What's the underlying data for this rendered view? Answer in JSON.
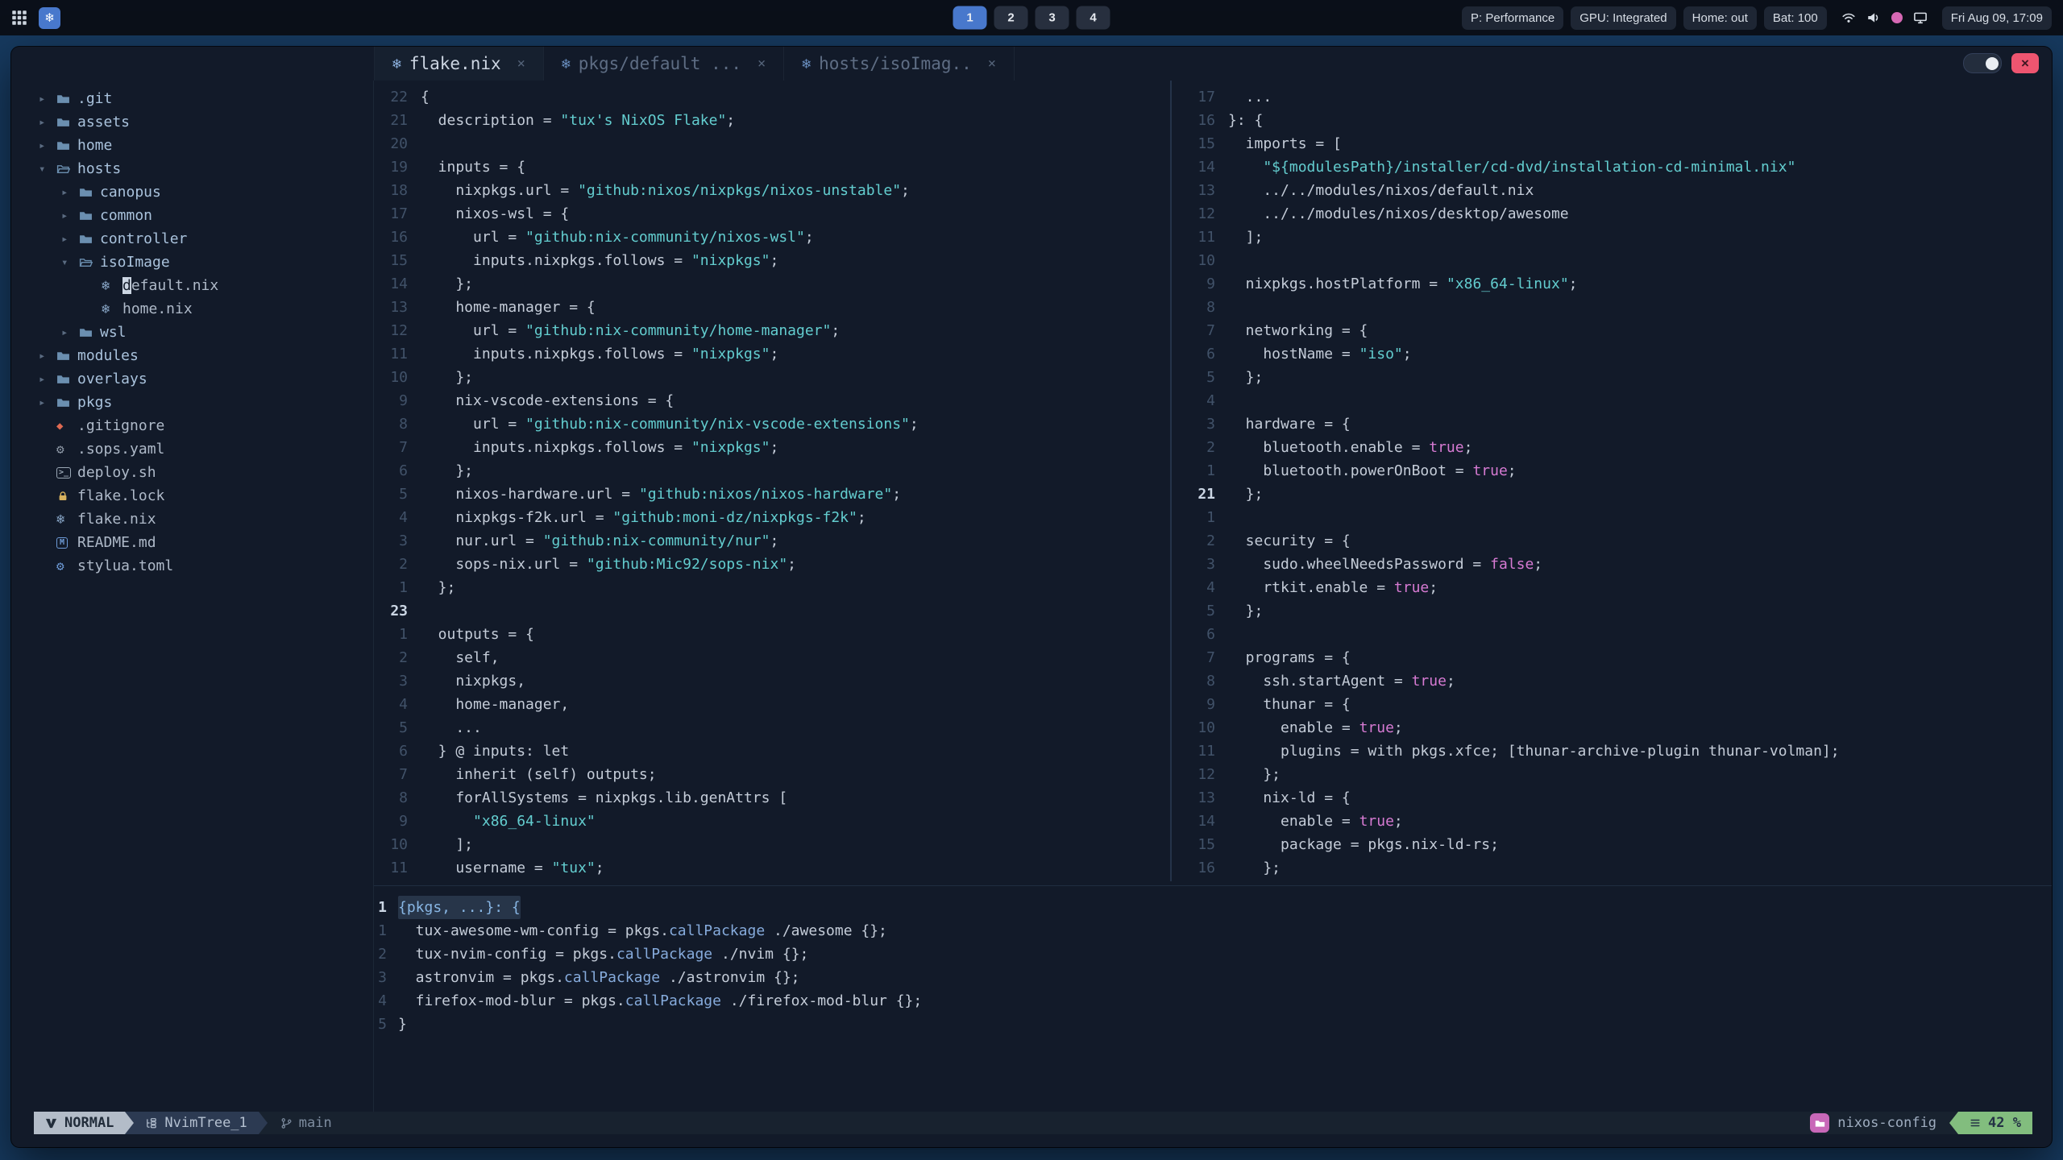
{
  "topbar": {
    "workspaces": {
      "items": [
        "1",
        "2",
        "3",
        "4"
      ],
      "active": "1"
    },
    "pills": [
      "P: Performance",
      "GPU: Integrated",
      "Home: out",
      "Bat: 100"
    ],
    "clock": "Fri Aug 09, 17:09"
  },
  "window": {
    "tabs": [
      {
        "label": "flake.nix",
        "active": true
      },
      {
        "label": "pkgs/default ...",
        "active": false
      },
      {
        "label": "hosts/isoImag..",
        "active": false
      }
    ]
  },
  "filetree": {
    "items": [
      {
        "label": ".git",
        "kind": "dir",
        "icon": "folder",
        "chev": "right",
        "depth": 0
      },
      {
        "label": "assets",
        "kind": "dir",
        "icon": "folder",
        "chev": "right",
        "depth": 0
      },
      {
        "label": "home",
        "kind": "dir",
        "icon": "folder",
        "chev": "right",
        "depth": 0
      },
      {
        "label": "hosts",
        "kind": "dir",
        "icon": "folder-open",
        "chev": "down",
        "depth": 0
      },
      {
        "label": "canopus",
        "kind": "dir",
        "icon": "folder",
        "chev": "right",
        "depth": 1
      },
      {
        "label": "common",
        "kind": "dir",
        "icon": "folder",
        "chev": "right",
        "depth": 1
      },
      {
        "label": "controller",
        "kind": "dir",
        "icon": "folder",
        "chev": "right",
        "depth": 1
      },
      {
        "label": "isoImage",
        "kind": "dir",
        "icon": "folder-open",
        "chev": "down",
        "depth": 1
      },
      {
        "label": "default.nix",
        "kind": "file",
        "icon": "nix",
        "depth": 2,
        "cursor": true
      },
      {
        "label": "home.nix",
        "kind": "file",
        "icon": "nix",
        "depth": 2
      },
      {
        "label": "wsl",
        "kind": "dir",
        "icon": "folder",
        "chev": "right",
        "depth": 1
      },
      {
        "label": "modules",
        "kind": "dir",
        "icon": "folder",
        "chev": "right",
        "depth": 0
      },
      {
        "label": "overlays",
        "kind": "dir",
        "icon": "folder",
        "chev": "right",
        "depth": 0
      },
      {
        "label": "pkgs",
        "kind": "dir",
        "icon": "folder",
        "chev": "right",
        "depth": 0
      },
      {
        "label": ".gitignore",
        "kind": "file",
        "icon": "git",
        "depth": 0
      },
      {
        "label": ".sops.yaml",
        "kind": "file",
        "icon": "gear",
        "depth": 0
      },
      {
        "label": "deploy.sh",
        "kind": "file",
        "icon": "sh",
        "depth": 0
      },
      {
        "label": "flake.lock",
        "kind": "file",
        "icon": "lock",
        "depth": 0
      },
      {
        "label": "flake.nix",
        "kind": "file",
        "icon": "nix",
        "depth": 0
      },
      {
        "label": "README.md",
        "kind": "file",
        "icon": "md",
        "depth": 0
      },
      {
        "label": "stylua.toml",
        "kind": "file",
        "icon": "toml",
        "depth": 0
      }
    ]
  },
  "editors": {
    "left": {
      "lines": [
        {
          "n": "22",
          "seg": [
            [
              "n",
              "{"
            ]
          ]
        },
        {
          "n": "21",
          "seg": [
            [
              "n",
              "  description = "
            ],
            [
              "s",
              "\"tux's NixOS Flake\""
            ],
            [
              "n",
              ";"
            ]
          ]
        },
        {
          "n": "20",
          "seg": []
        },
        {
          "n": "19",
          "seg": [
            [
              "n",
              "  inputs = {"
            ]
          ]
        },
        {
          "n": "18",
          "seg": [
            [
              "n",
              "    nixpkgs.url = "
            ],
            [
              "s",
              "\"github:nixos/nixpkgs/nixos-unstable\""
            ],
            [
              "n",
              ";"
            ]
          ]
        },
        {
          "n": "17",
          "seg": [
            [
              "n",
              "    nixos-wsl = {"
            ]
          ]
        },
        {
          "n": "16",
          "seg": [
            [
              "n",
              "      url = "
            ],
            [
              "s",
              "\"github:nix-community/nixos-wsl\""
            ],
            [
              "n",
              ";"
            ]
          ]
        },
        {
          "n": "15",
          "seg": [
            [
              "n",
              "      inputs.nixpkgs.follows = "
            ],
            [
              "s",
              "\"nixpkgs\""
            ],
            [
              "n",
              ";"
            ]
          ]
        },
        {
          "n": "14",
          "seg": [
            [
              "n",
              "    };"
            ]
          ]
        },
        {
          "n": "13",
          "seg": [
            [
              "n",
              "    home-manager = {"
            ]
          ]
        },
        {
          "n": "12",
          "seg": [
            [
              "n",
              "      url = "
            ],
            [
              "s",
              "\"github:nix-community/home-manager\""
            ],
            [
              "n",
              ";"
            ]
          ]
        },
        {
          "n": "11",
          "seg": [
            [
              "n",
              "      inputs.nixpkgs.follows = "
            ],
            [
              "s",
              "\"nixpkgs\""
            ],
            [
              "n",
              ";"
            ]
          ]
        },
        {
          "n": "10",
          "seg": [
            [
              "n",
              "    };"
            ]
          ]
        },
        {
          "n": "9",
          "seg": [
            [
              "n",
              "    nix-vscode-extensions = {"
            ]
          ]
        },
        {
          "n": "8",
          "seg": [
            [
              "n",
              "      url = "
            ],
            [
              "s",
              "\"github:nix-community/nix-vscode-extensions\""
            ],
            [
              "n",
              ";"
            ]
          ]
        },
        {
          "n": "7",
          "seg": [
            [
              "n",
              "      inputs.nixpkgs.follows = "
            ],
            [
              "s",
              "\"nixpkgs\""
            ],
            [
              "n",
              ";"
            ]
          ]
        },
        {
          "n": "6",
          "seg": [
            [
              "n",
              "    };"
            ]
          ]
        },
        {
          "n": "5",
          "seg": [
            [
              "n",
              "    nixos-hardware.url = "
            ],
            [
              "s",
              "\"github:nixos/nixos-hardware\""
            ],
            [
              "n",
              ";"
            ]
          ]
        },
        {
          "n": "4",
          "seg": [
            [
              "n",
              "    nixpkgs-f2k.url = "
            ],
            [
              "s",
              "\"github:moni-dz/nixpkgs-f2k\""
            ],
            [
              "n",
              ";"
            ]
          ]
        },
        {
          "n": "3",
          "seg": [
            [
              "n",
              "    nur.url = "
            ],
            [
              "s",
              "\"github:nix-community/nur\""
            ],
            [
              "n",
              ";"
            ]
          ]
        },
        {
          "n": "2",
          "seg": [
            [
              "n",
              "    sops-nix.url = "
            ],
            [
              "s",
              "\"github:Mic92/sops-nix\""
            ],
            [
              "n",
              ";"
            ]
          ]
        },
        {
          "n": "1",
          "seg": [
            [
              "n",
              "  };"
            ]
          ]
        },
        {
          "n": "23",
          "cur": true,
          "seg": []
        },
        {
          "n": "1",
          "seg": [
            [
              "n",
              "  outputs = {"
            ]
          ]
        },
        {
          "n": "2",
          "seg": [
            [
              "n",
              "    self,"
            ]
          ]
        },
        {
          "n": "3",
          "seg": [
            [
              "n",
              "    nixpkgs,"
            ]
          ]
        },
        {
          "n": "4",
          "seg": [
            [
              "n",
              "    home-manager,"
            ]
          ]
        },
        {
          "n": "5",
          "seg": [
            [
              "n",
              "    ..."
            ]
          ]
        },
        {
          "n": "6",
          "seg": [
            [
              "n",
              "  } @ inputs: let"
            ]
          ]
        },
        {
          "n": "7",
          "seg": [
            [
              "n",
              "    inherit (self) outputs;"
            ]
          ]
        },
        {
          "n": "8",
          "seg": [
            [
              "n",
              "    forAllSystems = nixpkgs.lib.genAttrs ["
            ]
          ]
        },
        {
          "n": "9",
          "seg": [
            [
              "s",
              "      \"x86_64-linux\""
            ]
          ]
        },
        {
          "n": "10",
          "seg": [
            [
              "n",
              "    ];"
            ]
          ]
        },
        {
          "n": "11",
          "seg": [
            [
              "n",
              "    username = "
            ],
            [
              "s",
              "\"tux\""
            ],
            [
              "n",
              ";"
            ]
          ]
        }
      ]
    },
    "right": {
      "lines": [
        {
          "n": "17",
          "seg": [
            [
              "n",
              "  ..."
            ]
          ]
        },
        {
          "n": "16",
          "seg": [
            [
              "n",
              "}: {"
            ]
          ]
        },
        {
          "n": "15",
          "seg": [
            [
              "n",
              "  imports = ["
            ]
          ]
        },
        {
          "n": "14",
          "seg": [
            [
              "s",
              "    \"${modulesPath}/installer/cd-dvd/installation-cd-minimal.nix\""
            ]
          ]
        },
        {
          "n": "13",
          "seg": [
            [
              "n",
              "    ../../modules/nixos/default.nix"
            ]
          ]
        },
        {
          "n": "12",
          "seg": [
            [
              "n",
              "    ../../modules/nixos/desktop/awesome"
            ]
          ]
        },
        {
          "n": "11",
          "seg": [
            [
              "n",
              "  ];"
            ]
          ]
        },
        {
          "n": "10",
          "seg": []
        },
        {
          "n": "9",
          "seg": [
            [
              "n",
              "  nixpkgs.hostPlatform = "
            ],
            [
              "s",
              "\"x86_64-linux\""
            ],
            [
              "n",
              ";"
            ]
          ]
        },
        {
          "n": "8",
          "seg": []
        },
        {
          "n": "7",
          "seg": [
            [
              "n",
              "  networking = {"
            ]
          ]
        },
        {
          "n": "6",
          "seg": [
            [
              "n",
              "    hostName = "
            ],
            [
              "s",
              "\"iso\""
            ],
            [
              "n",
              ";"
            ]
          ]
        },
        {
          "n": "5",
          "seg": [
            [
              "n",
              "  };"
            ]
          ]
        },
        {
          "n": "4",
          "seg": []
        },
        {
          "n": "3",
          "seg": [
            [
              "n",
              "  hardware = {"
            ]
          ]
        },
        {
          "n": "2",
          "seg": [
            [
              "n",
              "    bluetooth.enable = "
            ],
            [
              "b",
              "true"
            ],
            [
              "n",
              ";"
            ]
          ]
        },
        {
          "n": "1",
          "seg": [
            [
              "n",
              "    bluetooth.powerOnBoot = "
            ],
            [
              "b",
              "true"
            ],
            [
              "n",
              ";"
            ]
          ]
        },
        {
          "n": "21",
          "cur": true,
          "seg": [
            [
              "n",
              "  };"
            ]
          ]
        },
        {
          "n": "1",
          "seg": []
        },
        {
          "n": "2",
          "seg": [
            [
              "n",
              "  security = {"
            ]
          ]
        },
        {
          "n": "3",
          "seg": [
            [
              "n",
              "    sudo.wheelNeedsPassword = "
            ],
            [
              "b",
              "false"
            ],
            [
              "n",
              ";"
            ]
          ]
        },
        {
          "n": "4",
          "seg": [
            [
              "n",
              "    rtkit.enable = "
            ],
            [
              "b",
              "true"
            ],
            [
              "n",
              ";"
            ]
          ]
        },
        {
          "n": "5",
          "seg": [
            [
              "n",
              "  };"
            ]
          ]
        },
        {
          "n": "6",
          "seg": []
        },
        {
          "n": "7",
          "seg": [
            [
              "n",
              "  programs = {"
            ]
          ]
        },
        {
          "n": "8",
          "seg": [
            [
              "n",
              "    ssh.startAgent = "
            ],
            [
              "b",
              "true"
            ],
            [
              "n",
              ";"
            ]
          ]
        },
        {
          "n": "9",
          "seg": [
            [
              "n",
              "    thunar = {"
            ]
          ]
        },
        {
          "n": "10",
          "seg": [
            [
              "n",
              "      enable = "
            ],
            [
              "b",
              "true"
            ],
            [
              "n",
              ";"
            ]
          ]
        },
        {
          "n": "11",
          "seg": [
            [
              "n",
              "      plugins = with pkgs.xfce; [thunar-archive-plugin thunar-volman];"
            ]
          ]
        },
        {
          "n": "12",
          "seg": [
            [
              "n",
              "    };"
            ]
          ]
        },
        {
          "n": "13",
          "seg": [
            [
              "n",
              "    nix-ld = {"
            ]
          ]
        },
        {
          "n": "14",
          "seg": [
            [
              "n",
              "      enable = "
            ],
            [
              "b",
              "true"
            ],
            [
              "n",
              ";"
            ]
          ]
        },
        {
          "n": "15",
          "seg": [
            [
              "n",
              "      package = pkgs.nix-ld-rs;"
            ]
          ]
        },
        {
          "n": "16",
          "seg": [
            [
              "n",
              "    };"
            ]
          ]
        }
      ]
    },
    "bottom": {
      "lines": [
        {
          "n": "1",
          "cur": true,
          "hl": true,
          "seg": [
            [
              "h",
              "{pkgs, ...}: {"
            ]
          ]
        },
        {
          "n": "1",
          "seg": [
            [
              "n",
              "  tux-awesome-wm-config = pkgs."
            ],
            [
              "f",
              "callPackage"
            ],
            [
              "n",
              " ./awesome {};"
            ]
          ]
        },
        {
          "n": "2",
          "seg": [
            [
              "n",
              "  tux-nvim-config = pkgs."
            ],
            [
              "f",
              "callPackage"
            ],
            [
              "n",
              " ./nvim {};"
            ]
          ]
        },
        {
          "n": "3",
          "seg": [
            [
              "n",
              "  astronvim = pkgs."
            ],
            [
              "f",
              "callPackage"
            ],
            [
              "n",
              " ./astronvim {};"
            ]
          ]
        },
        {
          "n": "4",
          "seg": [
            [
              "n",
              "  firefox-mod-blur = pkgs."
            ],
            [
              "f",
              "callPackage"
            ],
            [
              "n",
              " ./firefox-mod-blur {};"
            ]
          ]
        },
        {
          "n": "5",
          "seg": [
            [
              "n",
              "}"
            ]
          ]
        }
      ]
    }
  },
  "statusline": {
    "mode": "NORMAL",
    "buffer": "NvimTree_1",
    "branch": "main",
    "project": "nixos-config",
    "percent": "42 %"
  }
}
